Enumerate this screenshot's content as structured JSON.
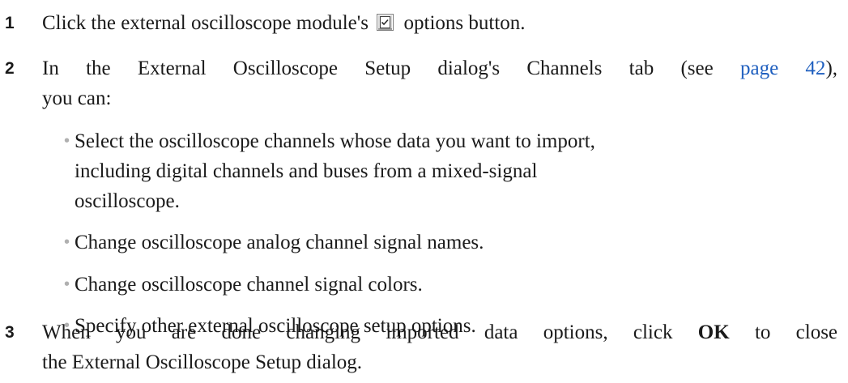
{
  "steps": [
    {
      "num": "1",
      "pre": "Click the external oscilloscope module's",
      "icon": "options-dialog-icon",
      "post": "options button."
    },
    {
      "num": "2",
      "line1_pre": "In the External Oscilloscope Setup dialog's Channels tab (see",
      "link": "page 42",
      "line1_post": "),",
      "line2": "you can:"
    },
    {
      "num": "3",
      "line1_pre": "When you are done changing imported data options, click",
      "bold": "OK",
      "line1_post": "to close",
      "line2": "the External Oscilloscope Setup dialog."
    }
  ],
  "bullets": [
    {
      "lines": [
        "Select the oscilloscope channels whose data you want to import,",
        "including digital channels and buses from a mixed-signal",
        "oscilloscope."
      ]
    },
    {
      "lines": [
        "Change oscilloscope analog channel signal names."
      ]
    },
    {
      "lines": [
        "Change oscilloscope channel signal colors."
      ]
    },
    {
      "lines": [
        "Specify other external oscilloscope setup options."
      ]
    }
  ],
  "colors": {
    "text": "#1a1a1a",
    "link": "#1f5fbf",
    "bullet": "#b0b0b0"
  }
}
